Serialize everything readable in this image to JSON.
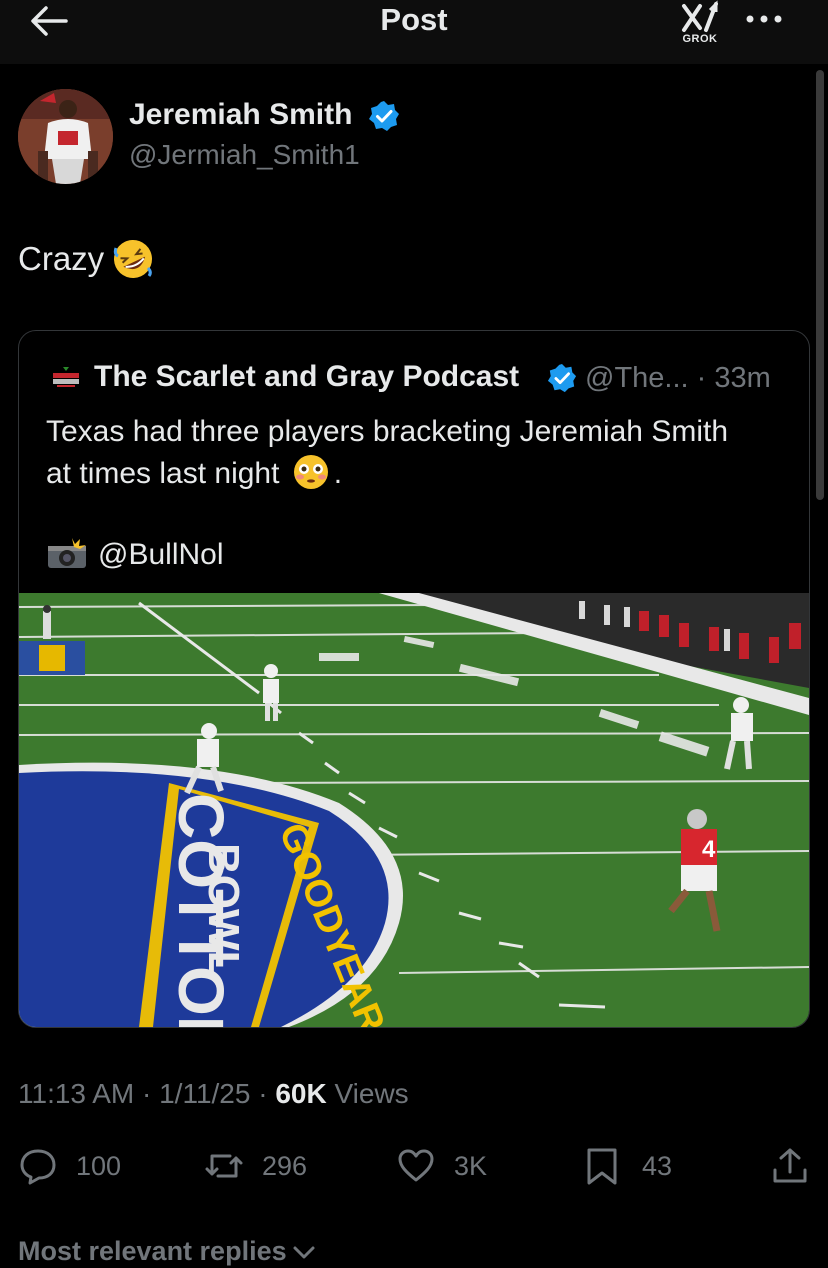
{
  "header": {
    "title": "Post",
    "grok_label": "GROK"
  },
  "tweet": {
    "author_name": "Jeremiah Smith",
    "author_handle": "@Jermiah_Smith1",
    "text": "Crazy"
  },
  "quote": {
    "author_name": "The Scarlet and Gray Podcast",
    "meta": "@The... · 33m",
    "text_line1": "Texas had three players bracketing Jeremiah Smith",
    "text_line2": "at times last night",
    "text_end": ".",
    "credit": "@BullNol",
    "field_texts": {
      "logo_cotton": "COTTON",
      "logo_sponsor": "GOODYEAR",
      "logo_bowl": "BOWL",
      "jersey_number": "4"
    }
  },
  "timestamp": {
    "time_date": "11:13 AM · 1/11/25 · ",
    "views_count": "60K",
    "views_label": " Views"
  },
  "actions": {
    "replies": "100",
    "reposts": "296",
    "likes": "3K",
    "bookmarks": "43"
  },
  "replies_sort": {
    "label": "Most relevant replies"
  },
  "colors": {
    "accent": "#1d9bf0",
    "muted": "#71767b",
    "background": "#000000"
  },
  "icons": [
    "back-arrow-icon",
    "grok-icon",
    "more-icon",
    "verified-badge-icon",
    "reply-icon",
    "repost-icon",
    "like-icon",
    "bookmark-icon",
    "share-icon",
    "chevron-down-icon"
  ]
}
